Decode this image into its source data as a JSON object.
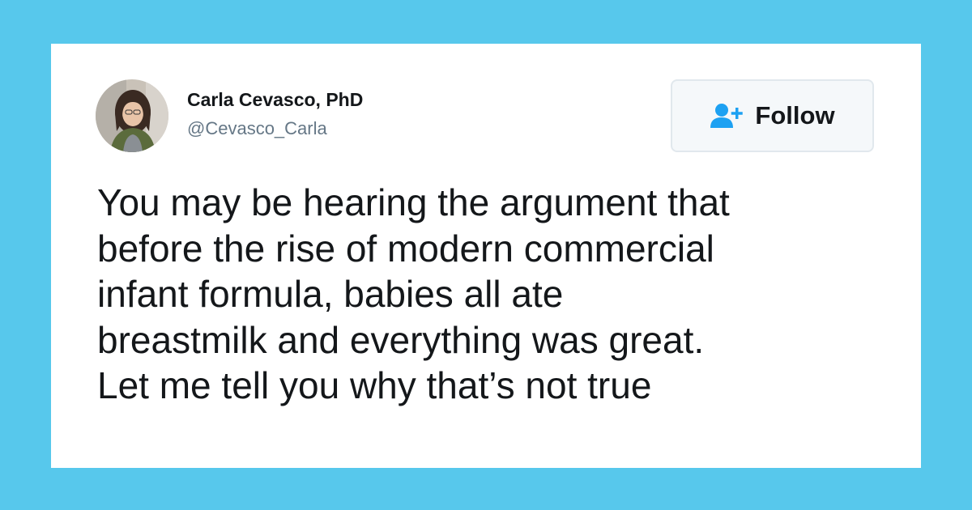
{
  "page": {
    "background_color": "#57c8ec"
  },
  "tweet": {
    "author": {
      "display_name": "Carla Cevasco, PhD",
      "handle": "@Cevasco_Carla",
      "avatar_icon": "profile-photo"
    },
    "follow_button": {
      "label": "Follow",
      "icon": "add-user-icon",
      "icon_color": "#1da1f2"
    },
    "text_lines": [
      "You may be hearing the argument that",
      "before the rise of modern commercial",
      "infant formula, babies all ate",
      "breastmilk and everything was great.",
      "Let me tell you why that’s not true"
    ]
  }
}
